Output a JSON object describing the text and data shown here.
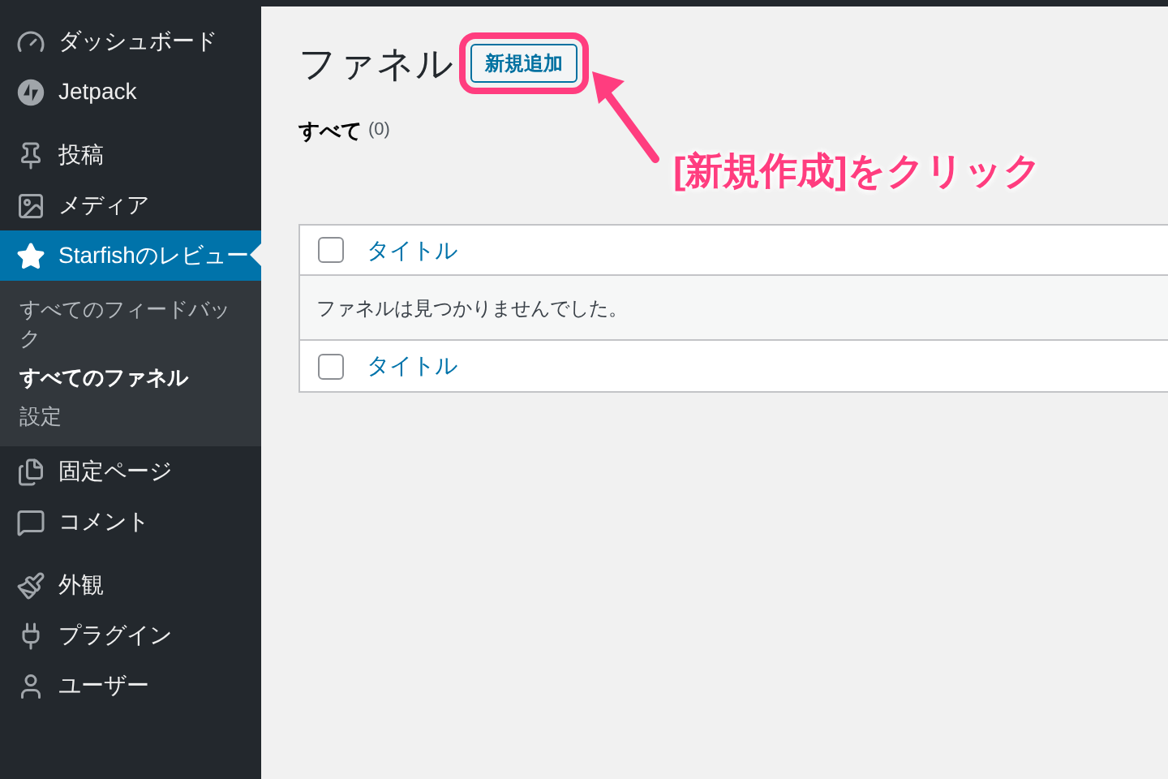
{
  "sidebar": {
    "menu_groups": [
      [
        {
          "label": "ダッシュボード",
          "selected": false
        },
        {
          "label": "Jetpack",
          "selected": false
        }
      ],
      [
        {
          "label": "投稿",
          "selected": false
        },
        {
          "label": "メディア",
          "selected": false
        },
        {
          "label": "Starfishのレビュー",
          "selected": true,
          "submenu": [
            {
              "label": "すべてのフィードバック",
              "selected": false
            },
            {
              "label": "すべてのファネル",
              "selected": true
            },
            {
              "label": "設定",
              "selected": false
            }
          ]
        },
        {
          "label": "固定ページ",
          "selected": false
        },
        {
          "label": "コメント",
          "selected": false
        }
      ],
      [
        {
          "label": "外観",
          "selected": false
        },
        {
          "label": "プラグイン",
          "selected": false
        },
        {
          "label": "ユーザー",
          "selected": false
        }
      ]
    ]
  },
  "page": {
    "title": "ファネル",
    "add_button": "新規追加",
    "filter": {
      "label": "すべて",
      "count": "(0)"
    }
  },
  "table": {
    "header": {
      "title": "タイトル",
      "checked": false
    },
    "empty_message": "ファネルは見つかりませんでした。",
    "footer": {
      "title": "タイトル",
      "checked": false
    }
  },
  "annotation": {
    "text": "[新規作成]をクリック"
  }
}
